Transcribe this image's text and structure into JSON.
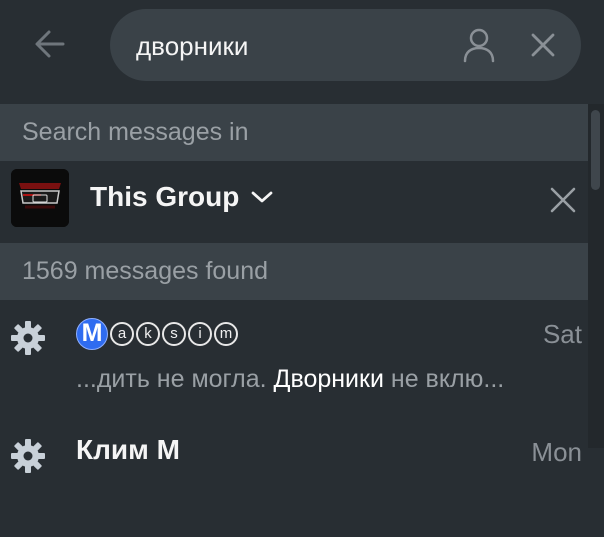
{
  "search": {
    "query": "дворники"
  },
  "sections": {
    "search_in_label": "Search messages in",
    "found_label": "1569 messages found"
  },
  "group": {
    "name": "This Group"
  },
  "results": [
    {
      "title_badge": "M",
      "title_letters": [
        "a",
        "k",
        "s",
        "i",
        "m"
      ],
      "date": "Sat",
      "snippet_before": "...дить не могла. ",
      "snippet_match": "Дворники",
      "snippet_after": " не вклю..."
    },
    {
      "title": "Клим М",
      "date": "Mon"
    }
  ],
  "colors": {
    "background": "#282e33",
    "section_bg": "#3a4248",
    "badge_blue": "#2f6cf0"
  }
}
